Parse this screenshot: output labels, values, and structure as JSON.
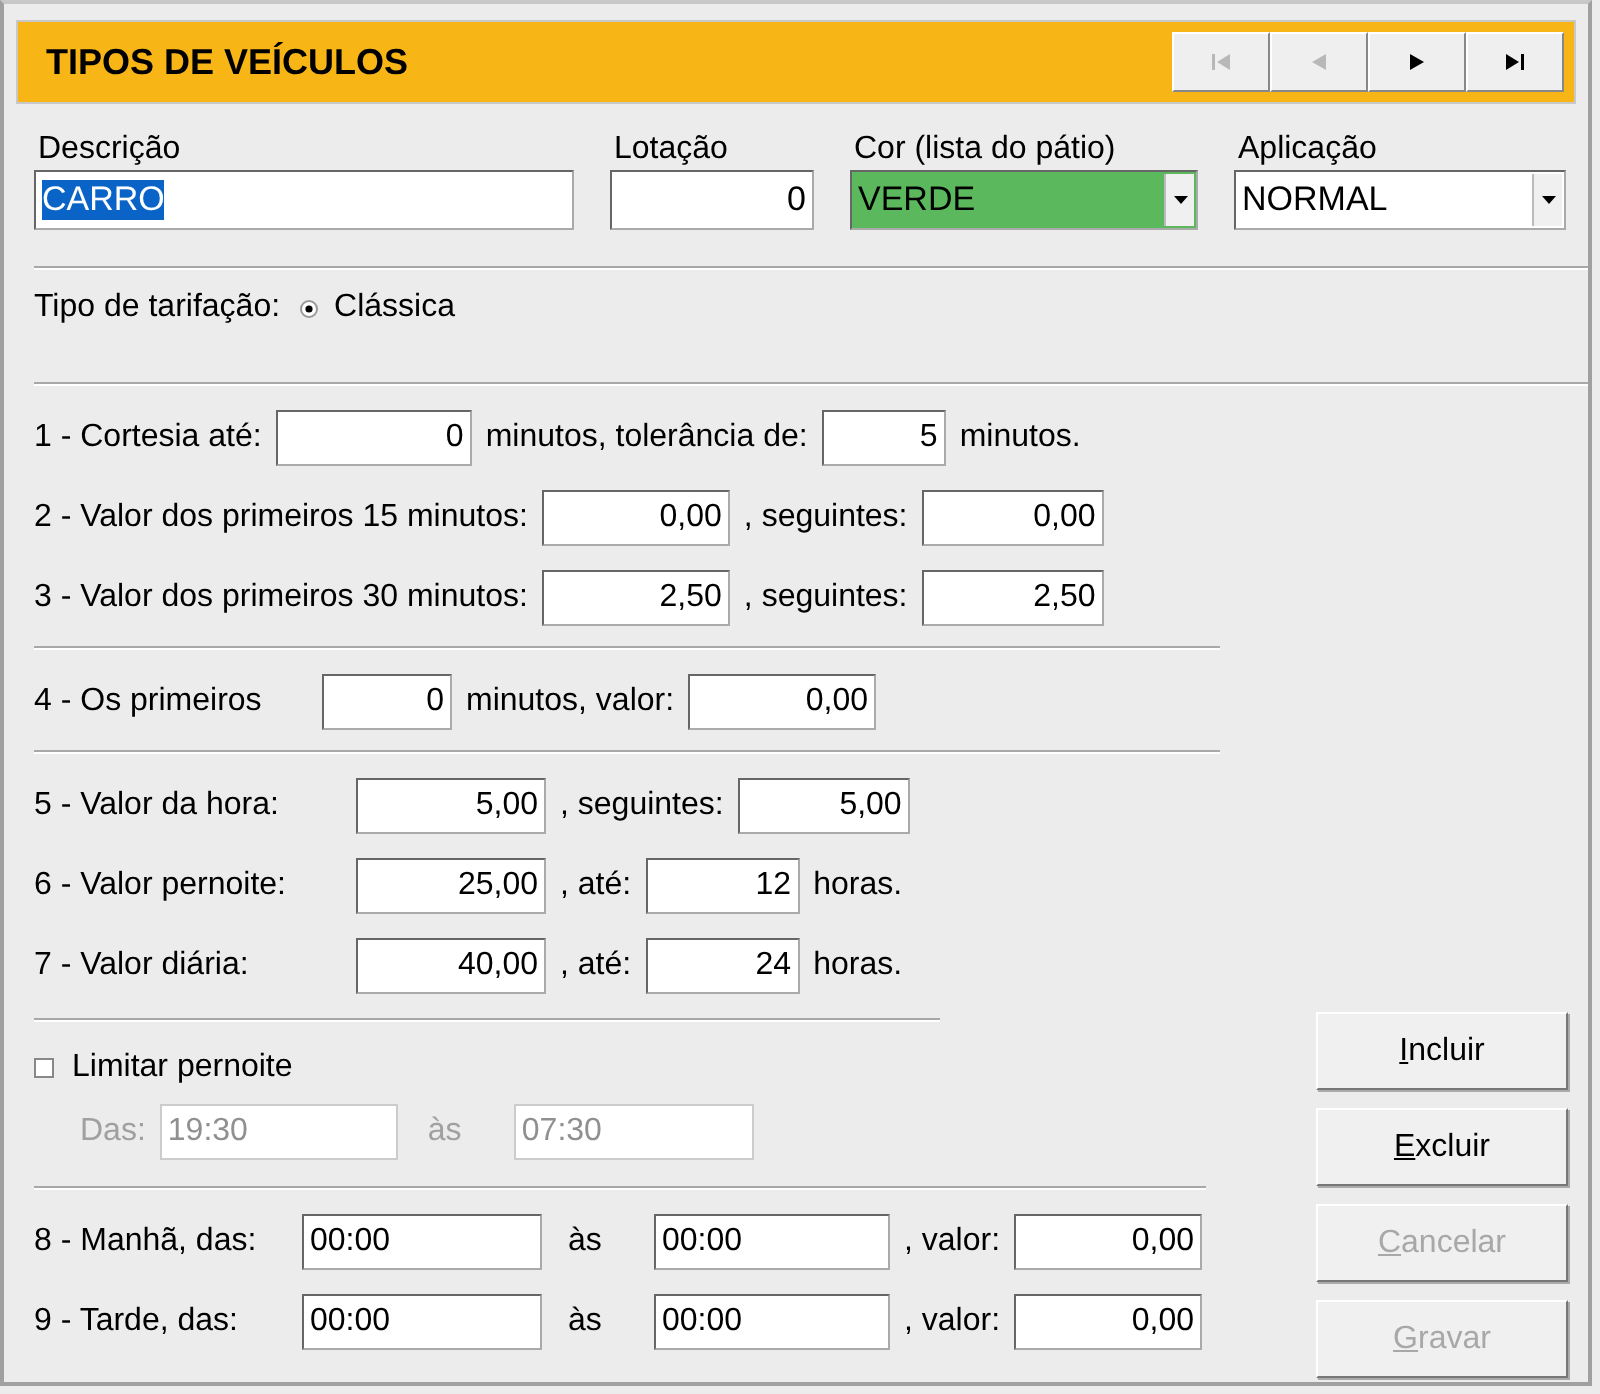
{
  "header": {
    "title": "TIPOS DE VEÍCULOS",
    "nav_buttons": [
      {
        "kind": "first",
        "disabled": true
      },
      {
        "kind": "previous",
        "disabled": true
      },
      {
        "kind": "next",
        "disabled": false
      },
      {
        "kind": "last",
        "disabled": false
      }
    ]
  },
  "top_fields": [
    {
      "label": "Descrição",
      "kind": "text",
      "value": "CARRO",
      "highlighted": true
    },
    {
      "label": "Lotação",
      "kind": "number",
      "value": "0"
    },
    {
      "label": "Cor (lista do pátio)",
      "kind": "select",
      "value": "VERDE",
      "color": "#5cb85c"
    },
    {
      "label": "Aplicação",
      "kind": "select",
      "value": "NORMAL"
    }
  ],
  "tarifacao": {
    "label": "Tipo de tarifação:",
    "options": [
      {
        "label": "Clássica",
        "selected": true
      }
    ]
  },
  "sections": [
    {
      "kind": "rows",
      "rows": [
        {
          "parts": [
            {
              "kind": "text",
              "text": "1 - Cortesia até:"
            },
            {
              "kind": "number",
              "value": "0"
            },
            {
              "kind": "text",
              "text": "minutos, tolerância de:"
            },
            {
              "kind": "number",
              "value": "5"
            },
            {
              "kind": "text",
              "text": "minutos."
            }
          ]
        },
        {
          "parts": [
            {
              "kind": "text",
              "text": "2 - Valor dos primeiros 15 minutos:"
            },
            {
              "kind": "number",
              "value": "0,00"
            },
            {
              "kind": "text",
              "text": ", seguintes:"
            },
            {
              "kind": "number",
              "value": "0,00"
            }
          ]
        },
        {
          "parts": [
            {
              "kind": "text",
              "text": "3 - Valor dos primeiros 30 minutos:"
            },
            {
              "kind": "number",
              "value": "2,50"
            },
            {
              "kind": "text",
              "text": ", seguintes:"
            },
            {
              "kind": "number",
              "value": "2,50"
            }
          ]
        }
      ]
    },
    {
      "kind": "rows",
      "rows": [
        {
          "parts": [
            {
              "kind": "text",
              "text": "4 - Os primeiros"
            },
            {
              "kind": "number",
              "value": "0"
            },
            {
              "kind": "text",
              "text": "minutos, valor:"
            },
            {
              "kind": "number",
              "value": "0,00"
            }
          ]
        }
      ]
    },
    {
      "kind": "rows",
      "rows": [
        {
          "parts": [
            {
              "kind": "text",
              "text": "5 - Valor da hora:"
            },
            {
              "kind": "number",
              "value": "5,00"
            },
            {
              "kind": "text",
              "text": ", seguintes:"
            },
            {
              "kind": "number",
              "value": "5,00"
            }
          ]
        },
        {
          "parts": [
            {
              "kind": "text",
              "text": "6 - Valor pernoite:"
            },
            {
              "kind": "number",
              "value": "25,00"
            },
            {
              "kind": "text",
              "text": ", até:"
            },
            {
              "kind": "number",
              "value": "12"
            },
            {
              "kind": "text",
              "text": "horas."
            }
          ]
        },
        {
          "parts": [
            {
              "kind": "text",
              "text": "7 - Valor diária:"
            },
            {
              "kind": "number",
              "value": "40,00"
            },
            {
              "kind": "text",
              "text": ", até:"
            },
            {
              "kind": "number",
              "value": "24"
            },
            {
              "kind": "text",
              "text": "horas."
            }
          ]
        }
      ]
    },
    {
      "kind": "limit",
      "label": "Limitar pernoite",
      "checked": false,
      "disabled": true,
      "from_label": "Das:",
      "from": "19:30",
      "to_label": "às",
      "to": "07:30"
    },
    {
      "kind": "rows",
      "rows": [
        {
          "parts": [
            {
              "kind": "text",
              "text": "8 - Manhã, das:"
            },
            {
              "kind": "time",
              "value": "00:00"
            },
            {
              "kind": "text",
              "text": "às"
            },
            {
              "kind": "time",
              "value": "00:00"
            },
            {
              "kind": "text",
              "text": ", valor:"
            },
            {
              "kind": "number",
              "value": "0,00"
            }
          ]
        },
        {
          "parts": [
            {
              "kind": "text",
              "text": "9 - Tarde, das:"
            },
            {
              "kind": "time",
              "value": "00:00"
            },
            {
              "kind": "text",
              "text": "às"
            },
            {
              "kind": "time",
              "value": "00:00"
            },
            {
              "kind": "text",
              "text": ", valor:"
            },
            {
              "kind": "number",
              "value": "0,00"
            }
          ]
        }
      ]
    }
  ],
  "buttons": [
    {
      "label": "Incluir",
      "disabled": false
    },
    {
      "label": "Excluir",
      "disabled": false
    },
    {
      "label": "Cancelar",
      "disabled": true
    },
    {
      "label": "Gravar",
      "disabled": true
    }
  ]
}
